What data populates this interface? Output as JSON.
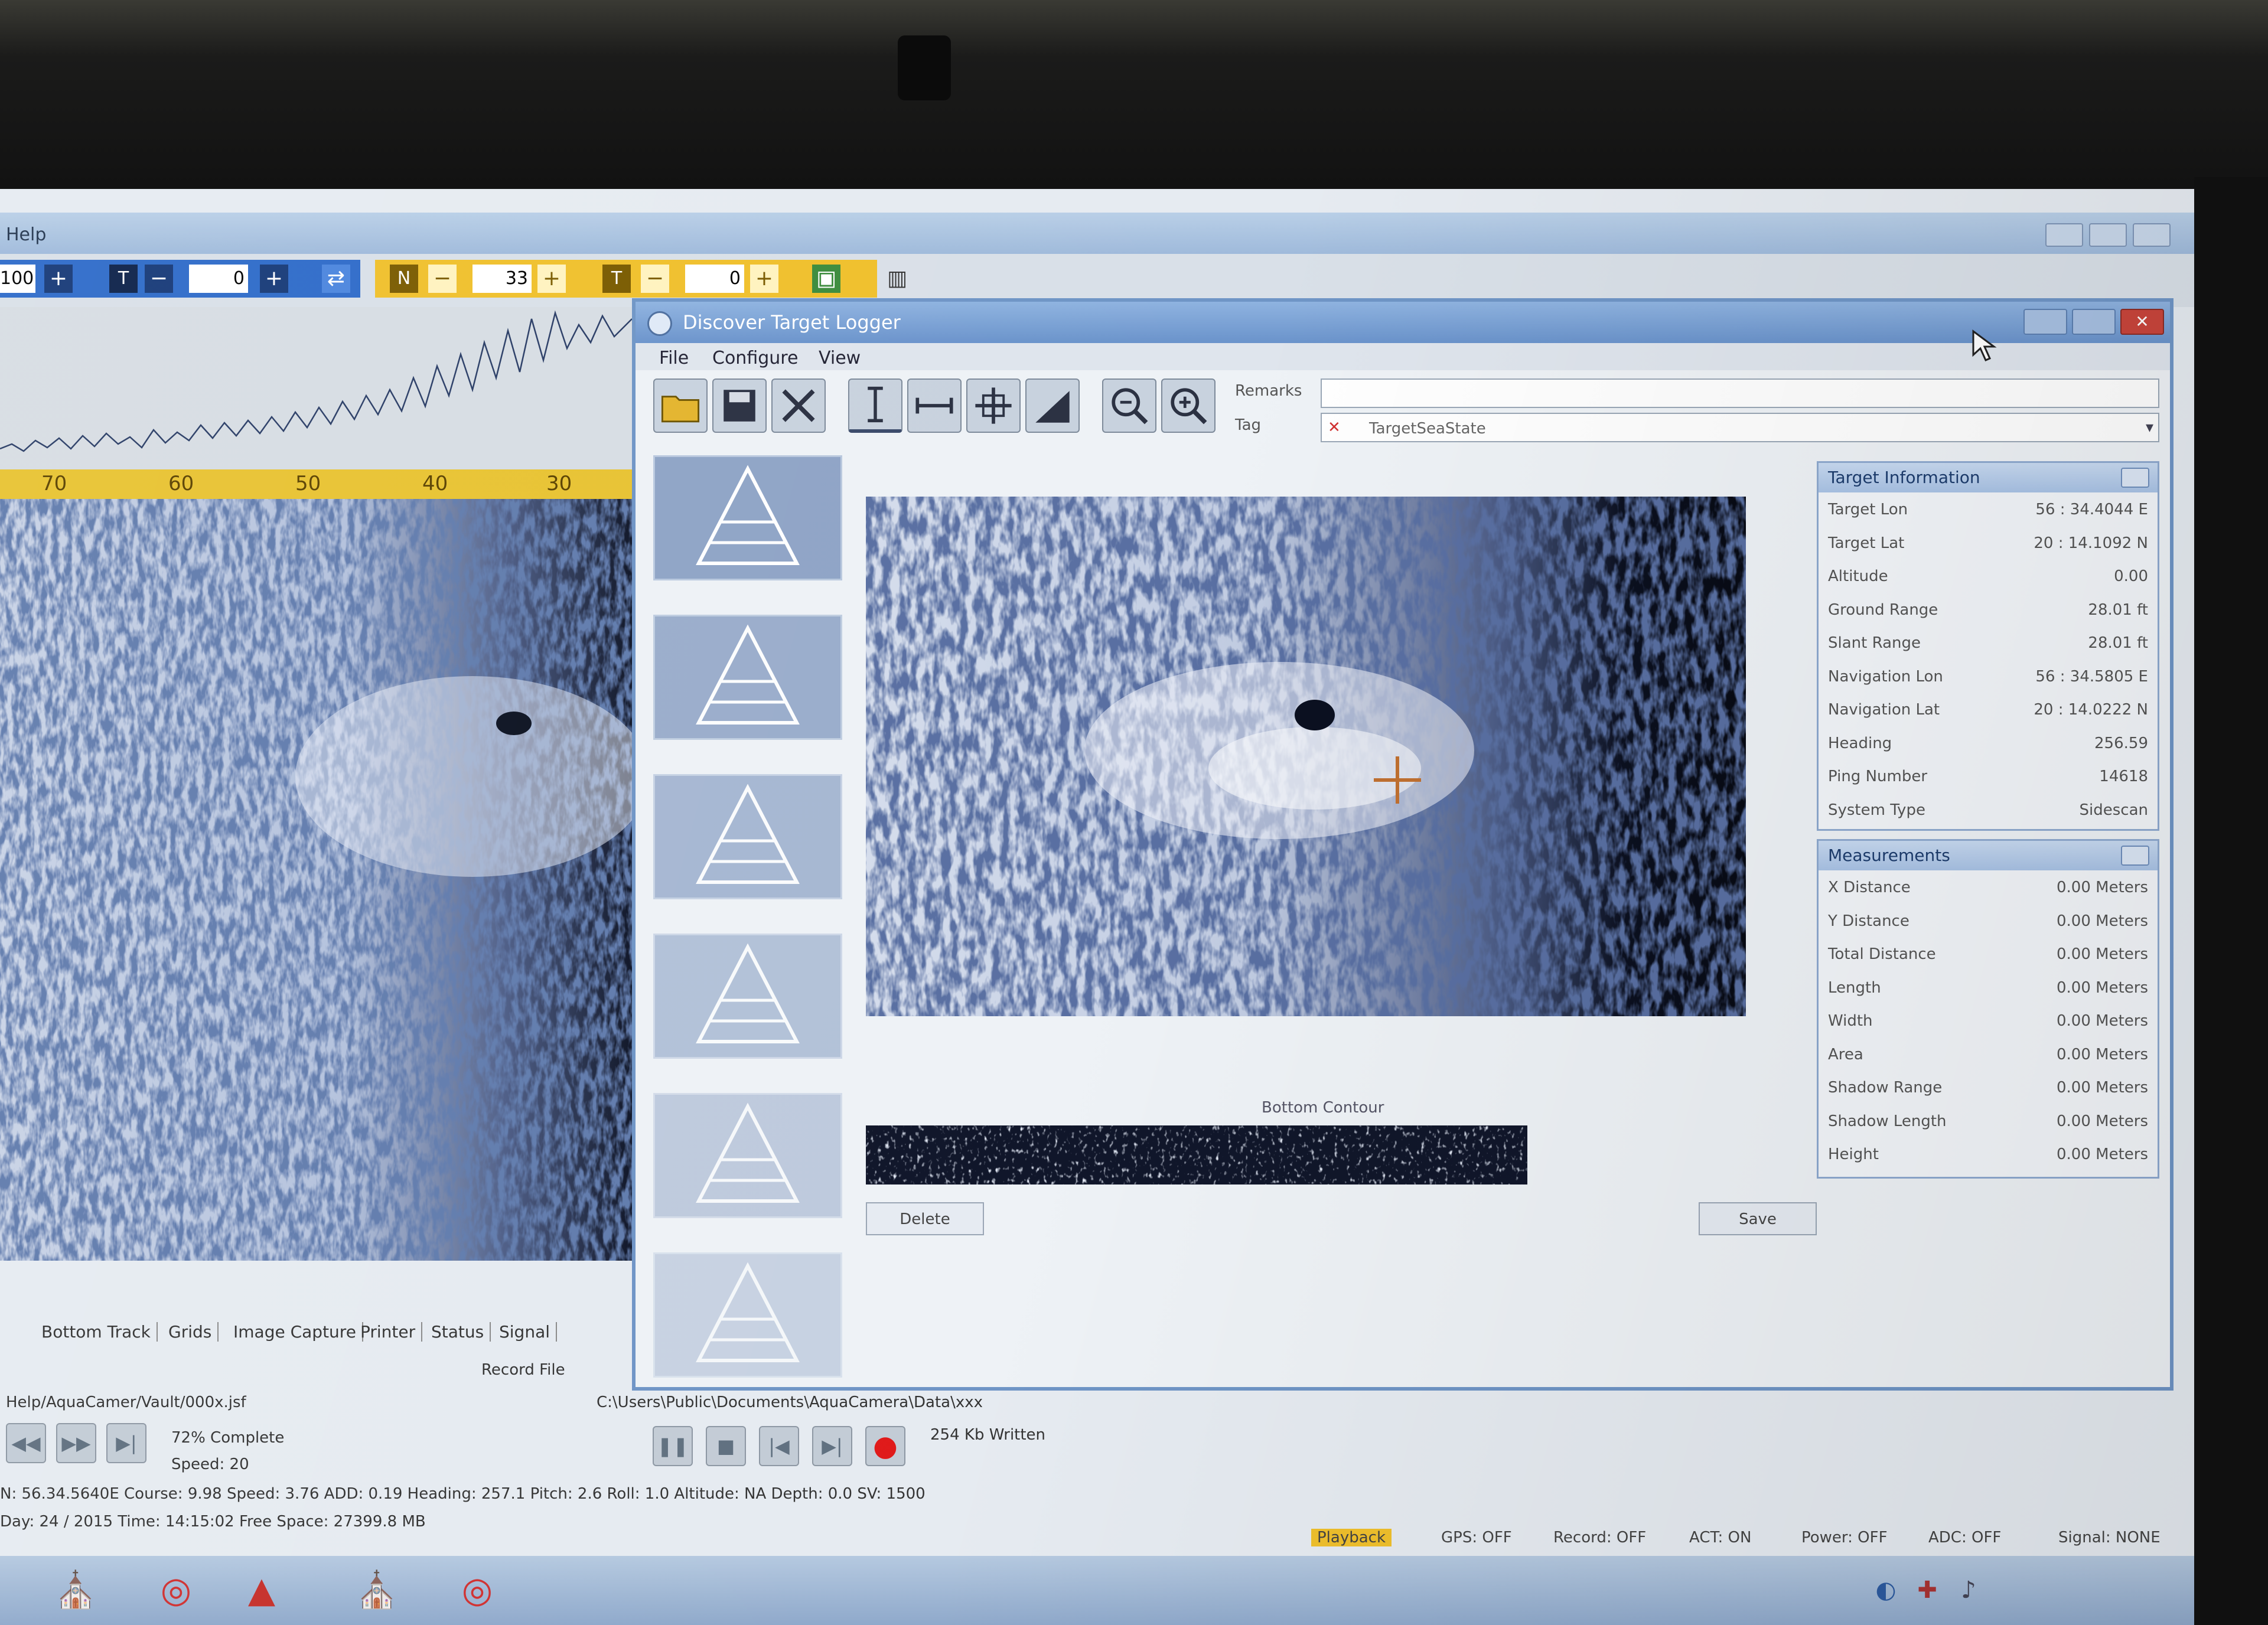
{
  "app": {
    "title": "Help",
    "toolbar": {
      "blue_field1": "100",
      "blue_field2": "0",
      "yellow_field1": "33",
      "yellow_field2": "0",
      "plus": "+",
      "minus": "−"
    },
    "ruler_labels": [
      "70",
      "60",
      "50",
      "40",
      "30"
    ],
    "tabs": [
      "Bottom Track",
      "Grids",
      "Image Capture",
      "Printer",
      "Status",
      "Signal"
    ],
    "record_file_label": "Record File",
    "file_path": "Help/AquaCamer/Vault/000x.jsf",
    "record_path": "C:\\Users\\Public\\Documents\\AquaCamera\\Data\\xxx",
    "complete_text": "72% Complete",
    "speed_text": "Speed: 20",
    "written_text": "254 Kb Written",
    "nav_line": "N: 56.34.5640E   Course: 9.98   Speed: 3.76  ADD: 0.19  Heading: 257.1  Pitch: 2.6  Roll: 1.0  Altitude: NA  Depth: 0.0  SV: 1500",
    "date_line": "Day: 24 / 2015  Time: 14:15:02     Free Space: 27399.8 MB",
    "status": {
      "playback": "Playback",
      "gps": "GPS: OFF",
      "record": "Record: OFF",
      "act": "ACT: ON",
      "power": "Power: OFF",
      "adc": "ADC: OFF",
      "signal": "Signal: NONE"
    },
    "colors": {
      "toolbar_blue": "#2e6bc9",
      "toolbar_yellow": "#f0c02c",
      "record_red": "#e01a1a",
      "title_blue": "#6a93cb"
    }
  },
  "dialog": {
    "title": "Discover Target Logger",
    "menu": [
      "File",
      "Configure",
      "View"
    ],
    "remarks_label": "Remarks",
    "tag_label": "Tag",
    "tag_value": "TargetSeaState",
    "bottom_contour_label": "Bottom Contour",
    "delete_button": "Delete",
    "save_button": "Save",
    "target_info": {
      "title": "Target Information",
      "rows": [
        {
          "k": "Target Lon",
          "v": "56 : 34.4044 E"
        },
        {
          "k": "Target Lat",
          "v": "20 : 14.1092 N"
        },
        {
          "k": "Altitude",
          "v": "0.00"
        },
        {
          "k": "Ground Range",
          "v": "28.01 ft"
        },
        {
          "k": "Slant Range",
          "v": "28.01 ft"
        },
        {
          "k": "Navigation Lon",
          "v": "56 : 34.5805 E"
        },
        {
          "k": "Navigation Lat",
          "v": "20 : 14.0222 N"
        },
        {
          "k": "Heading",
          "v": "256.59"
        },
        {
          "k": "Ping Number",
          "v": "14618"
        },
        {
          "k": "System Type",
          "v": "Sidescan"
        }
      ]
    },
    "measurements": {
      "title": "Measurements",
      "rows": [
        {
          "k": "X Distance",
          "v": "0.00 Meters"
        },
        {
          "k": "Y Distance",
          "v": "0.00 Meters"
        },
        {
          "k": "Total Distance",
          "v": "0.00 Meters"
        },
        {
          "k": "Length",
          "v": "0.00 Meters"
        },
        {
          "k": "Width",
          "v": "0.00 Meters"
        },
        {
          "k": "Area",
          "v": "0.00 Meters"
        },
        {
          "k": "Shadow Range",
          "v": "0.00 Meters"
        },
        {
          "k": "Shadow Length",
          "v": "0.00 Meters"
        },
        {
          "k": "Height",
          "v": "0.00 Meters"
        }
      ]
    }
  }
}
